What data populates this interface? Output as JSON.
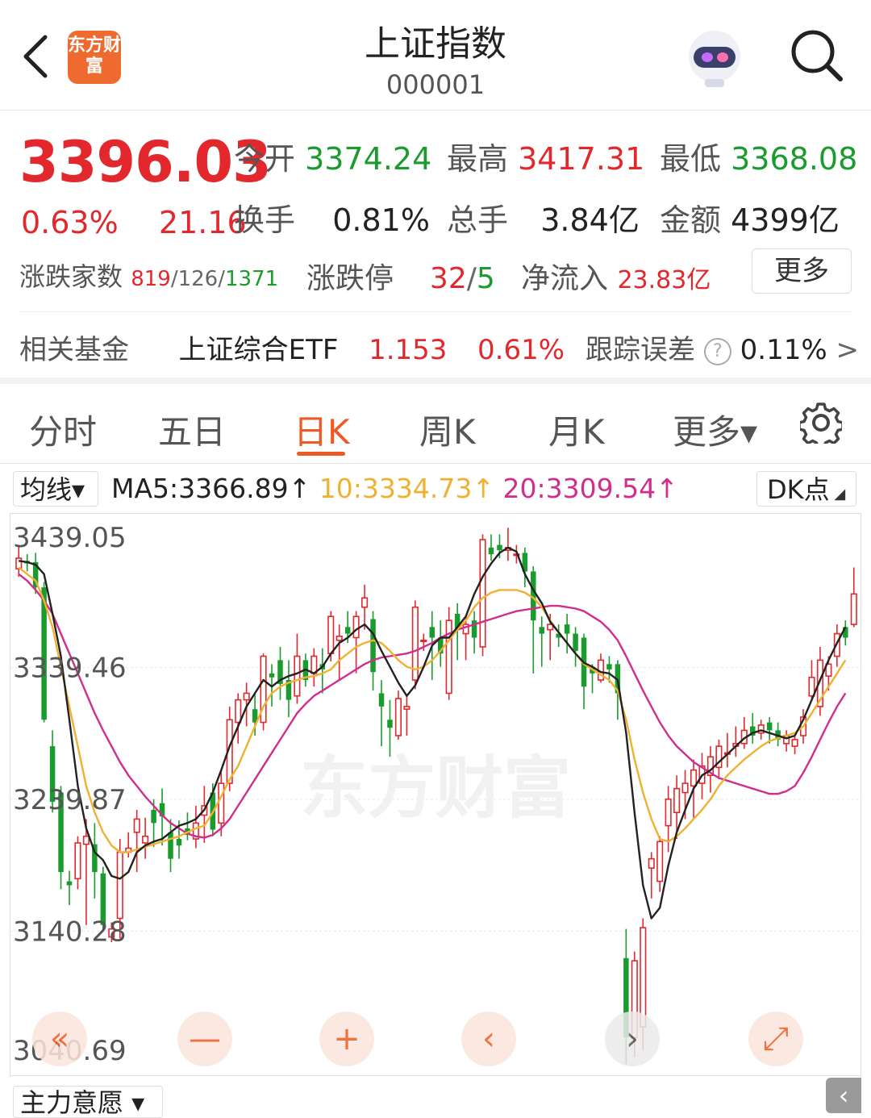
{
  "header": {
    "back_icon": "chevron-left-icon",
    "logo_text": "东方财富",
    "title": "上证指数",
    "code": "000001",
    "robot_icon": "robot-avatar-icon",
    "search_icon": "search-icon"
  },
  "quote": {
    "price": "3396.03",
    "change_pct": "0.63%",
    "change": "21.16",
    "open_label": "今开",
    "open": "3374.24",
    "high_label": "最高",
    "high": "3417.31",
    "low_label": "最低",
    "low": "3368.08",
    "turnover_label": "换手",
    "turnover": "0.81%",
    "volume_label": "总手",
    "volume": "3.84亿",
    "amount_label": "金额",
    "amount": "4399亿",
    "breadth_label": "涨跌家数",
    "breadth_up": "819",
    "breadth_sep1": "/",
    "breadth_flat": "126",
    "breadth_sep2": "/",
    "breadth_down": "1371",
    "limit_label": "涨跌停",
    "limit_up": "32",
    "limit_sep": "/",
    "limit_down": "5",
    "netflow_label": "净流入",
    "netflow": "23.83亿",
    "more_label": "更多"
  },
  "fund": {
    "label": "相关基金",
    "name": "上证综合ETF",
    "price": "1.153",
    "change_pct": "0.61%",
    "tracking_label": "跟踪误差",
    "tracking_value": "0.11%",
    "arrow": ">"
  },
  "tabs": [
    {
      "label": "分时"
    },
    {
      "label": "五日"
    },
    {
      "label": "日K"
    },
    {
      "label": "周K"
    },
    {
      "label": "月K"
    },
    {
      "label": "更多▾"
    }
  ],
  "active_tab": "日K",
  "ma": {
    "select_label": "均线▾",
    "ma5": "MA5:3366.89↑",
    "ma10": "10:3334.73↑",
    "ma20": "20:3309.54↑",
    "dk_label": "DK点",
    "ma5_color": "#222222",
    "ma10_color": "#f0b132",
    "ma20_color": "#d12e8c"
  },
  "chart_data": {
    "type": "candlestick",
    "y_ticks": [
      "3439.05",
      "3339.46",
      "3239.87",
      "3140.28",
      "3040.69"
    ],
    "ylim": [
      3040.69,
      3439.05
    ],
    "watermark": "东方财富",
    "colors": {
      "up": "#e2282d",
      "down": "#1a9b2e"
    },
    "candles": [
      {
        "o": 3414,
        "c": 3422,
        "h": 3432,
        "l": 3408
      },
      {
        "o": 3420,
        "c": 3418,
        "h": 3425,
        "l": 3412
      },
      {
        "o": 3419,
        "c": 3400,
        "h": 3426,
        "l": 3395
      },
      {
        "o": 3400,
        "c": 3300,
        "h": 3404,
        "l": 3298
      },
      {
        "o": 3280,
        "c": 3238,
        "h": 3292,
        "l": 3230
      },
      {
        "o": 3245,
        "c": 3185,
        "h": 3250,
        "l": 3172
      },
      {
        "o": 3178,
        "c": 3175,
        "h": 3186,
        "l": 3160
      },
      {
        "o": 3180,
        "c": 3207,
        "h": 3212,
        "l": 3172
      },
      {
        "o": 3206,
        "c": 3212,
        "h": 3225,
        "l": 3145
      },
      {
        "o": 3206,
        "c": 3185,
        "h": 3222,
        "l": 3165
      },
      {
        "o": 3184,
        "c": 3145,
        "h": 3189,
        "l": 3140
      },
      {
        "o": 3136,
        "c": 3142,
        "h": 3147,
        "l": 3132
      },
      {
        "o": 3150,
        "c": 3200,
        "h": 3210,
        "l": 3135
      },
      {
        "o": 3200,
        "c": 3203,
        "h": 3215,
        "l": 3196
      },
      {
        "o": 3215,
        "c": 3225,
        "h": 3232,
        "l": 3185
      },
      {
        "o": 3207,
        "c": 3212,
        "h": 3226,
        "l": 3195
      },
      {
        "o": 3232,
        "c": 3222,
        "h": 3240,
        "l": 3204
      },
      {
        "o": 3237,
        "c": 3227,
        "h": 3248,
        "l": 3205
      },
      {
        "o": 3215,
        "c": 3195,
        "h": 3225,
        "l": 3185
      },
      {
        "o": 3210,
        "c": 3205,
        "h": 3224,
        "l": 3195
      },
      {
        "o": 3218,
        "c": 3213,
        "h": 3230,
        "l": 3209
      },
      {
        "o": 3210,
        "c": 3222,
        "h": 3235,
        "l": 3203
      },
      {
        "o": 3228,
        "c": 3235,
        "h": 3250,
        "l": 3207
      },
      {
        "o": 3245,
        "c": 3217,
        "h": 3252,
        "l": 3212
      },
      {
        "o": 3222,
        "c": 3252,
        "h": 3262,
        "l": 3212
      },
      {
        "o": 3252,
        "c": 3300,
        "h": 3310,
        "l": 3246
      },
      {
        "o": 3298,
        "c": 3315,
        "h": 3320,
        "l": 3282
      },
      {
        "o": 3315,
        "c": 3320,
        "h": 3328,
        "l": 3295
      },
      {
        "o": 3308,
        "c": 3298,
        "h": 3320,
        "l": 3288
      },
      {
        "o": 3298,
        "c": 3348,
        "h": 3350,
        "l": 3292
      },
      {
        "o": 3335,
        "c": 3332,
        "h": 3342,
        "l": 3310
      },
      {
        "o": 3345,
        "c": 3327,
        "h": 3355,
        "l": 3315
      },
      {
        "o": 3330,
        "c": 3315,
        "h": 3345,
        "l": 3302
      },
      {
        "o": 3318,
        "c": 3348,
        "h": 3365,
        "l": 3312
      },
      {
        "o": 3345,
        "c": 3330,
        "h": 3350,
        "l": 3325
      },
      {
        "o": 3335,
        "c": 3348,
        "h": 3354,
        "l": 3325
      },
      {
        "o": 3342,
        "c": 3338,
        "h": 3354,
        "l": 3320
      },
      {
        "o": 3350,
        "c": 3378,
        "h": 3382,
        "l": 3344
      },
      {
        "o": 3360,
        "c": 3363,
        "h": 3372,
        "l": 3330
      },
      {
        "o": 3370,
        "c": 3365,
        "h": 3382,
        "l": 3358
      },
      {
        "o": 3362,
        "c": 3378,
        "h": 3382,
        "l": 3335
      },
      {
        "o": 3385,
        "c": 3392,
        "h": 3402,
        "l": 3368
      },
      {
        "o": 3376,
        "c": 3336,
        "h": 3382,
        "l": 3322
      },
      {
        "o": 3320,
        "c": 3310,
        "h": 3330,
        "l": 3280
      },
      {
        "o": 3300,
        "c": 3294,
        "h": 3315,
        "l": 3272
      },
      {
        "o": 3288,
        "c": 3316,
        "h": 3322,
        "l": 3285
      },
      {
        "o": 3308,
        "c": 3310,
        "h": 3318,
        "l": 3288
      },
      {
        "o": 3330,
        "c": 3385,
        "h": 3390,
        "l": 3323
      },
      {
        "o": 3360,
        "c": 3360,
        "h": 3365,
        "l": 3352
      },
      {
        "o": 3370,
        "c": 3362,
        "h": 3382,
        "l": 3330
      },
      {
        "o": 3362,
        "c": 3350,
        "h": 3375,
        "l": 3340
      },
      {
        "o": 3320,
        "c": 3375,
        "h": 3385,
        "l": 3315
      },
      {
        "o": 3380,
        "c": 3368,
        "h": 3388,
        "l": 3345
      },
      {
        "o": 3365,
        "c": 3372,
        "h": 3378,
        "l": 3345
      },
      {
        "o": 3375,
        "c": 3362,
        "h": 3382,
        "l": 3350
      },
      {
        "o": 3355,
        "c": 3436,
        "h": 3440,
        "l": 3348
      },
      {
        "o": 3430,
        "c": 3425,
        "h": 3440,
        "l": 3420
      },
      {
        "o": 3432,
        "c": 3428,
        "h": 3440,
        "l": 3422
      },
      {
        "o": 3428,
        "c": 3430,
        "h": 3445,
        "l": 3420
      },
      {
        "o": 3425,
        "c": 3425,
        "h": 3432,
        "l": 3418
      },
      {
        "o": 3426,
        "c": 3412,
        "h": 3430,
        "l": 3400
      },
      {
        "o": 3412,
        "c": 3375,
        "h": 3416,
        "l": 3335
      },
      {
        "o": 3370,
        "c": 3365,
        "h": 3378,
        "l": 3340
      },
      {
        "o": 3368,
        "c": 3372,
        "h": 3380,
        "l": 3345
      },
      {
        "o": 3365,
        "c": 3362,
        "h": 3372,
        "l": 3355
      },
      {
        "o": 3372,
        "c": 3365,
        "h": 3380,
        "l": 3350
      },
      {
        "o": 3365,
        "c": 3352,
        "h": 3370,
        "l": 3340
      },
      {
        "o": 3362,
        "c": 3325,
        "h": 3365,
        "l": 3308
      },
      {
        "o": 3340,
        "c": 3335,
        "h": 3342,
        "l": 3320
      },
      {
        "o": 3330,
        "c": 3345,
        "h": 3350,
        "l": 3328
      },
      {
        "o": 3342,
        "c": 3338,
        "h": 3348,
        "l": 3328
      },
      {
        "o": 3342,
        "c": 3320,
        "h": 3345,
        "l": 3300
      },
      {
        "o": 3120,
        "c": 3060,
        "h": 3142,
        "l": 3040
      },
      {
        "o": 3060,
        "c": 3118,
        "h": 3125,
        "l": 3045
      },
      {
        "o": 3068,
        "c": 3143,
        "h": 3150,
        "l": 3050
      },
      {
        "o": 3188,
        "c": 3195,
        "h": 3200,
        "l": 3165
      },
      {
        "o": 3178,
        "c": 3208,
        "h": 3212,
        "l": 3170
      },
      {
        "o": 3220,
        "c": 3240,
        "h": 3250,
        "l": 3200
      },
      {
        "o": 3230,
        "c": 3248,
        "h": 3258,
        "l": 3210
      },
      {
        "o": 3245,
        "c": 3252,
        "h": 3262,
        "l": 3225
      },
      {
        "o": 3250,
        "c": 3262,
        "h": 3270,
        "l": 3225
      },
      {
        "o": 3252,
        "c": 3265,
        "h": 3275,
        "l": 3240
      },
      {
        "o": 3258,
        "c": 3272,
        "h": 3280,
        "l": 3245
      },
      {
        "o": 3264,
        "c": 3280,
        "h": 3285,
        "l": 3255
      },
      {
        "o": 3274,
        "c": 3275,
        "h": 3290,
        "l": 3264
      },
      {
        "o": 3280,
        "c": 3282,
        "h": 3295,
        "l": 3272
      },
      {
        "o": 3282,
        "c": 3292,
        "h": 3302,
        "l": 3278
      },
      {
        "o": 3295,
        "c": 3288,
        "h": 3305,
        "l": 3282
      },
      {
        "o": 3290,
        "c": 3296,
        "h": 3300,
        "l": 3285
      },
      {
        "o": 3298,
        "c": 3292,
        "h": 3302,
        "l": 3282
      },
      {
        "o": 3292,
        "c": 3285,
        "h": 3298,
        "l": 3280
      },
      {
        "o": 3282,
        "c": 3288,
        "h": 3292,
        "l": 3276
      },
      {
        "o": 3280,
        "c": 3285,
        "h": 3290,
        "l": 3274
      },
      {
        "o": 3288,
        "c": 3302,
        "h": 3308,
        "l": 3282
      },
      {
        "o": 3318,
        "c": 3332,
        "h": 3345,
        "l": 3315
      },
      {
        "o": 3310,
        "c": 3345,
        "h": 3355,
        "l": 3303
      },
      {
        "o": 3333,
        "c": 3342,
        "h": 3348,
        "l": 3322
      },
      {
        "o": 3348,
        "c": 3365,
        "h": 3372,
        "l": 3340
      },
      {
        "o": 3370,
        "c": 3362,
        "h": 3375,
        "l": 3356
      },
      {
        "o": 3372,
        "c": 3395,
        "h": 3415,
        "l": 3370
      }
    ],
    "ma5": [
      3420,
      3419,
      3417,
      3410,
      3380,
      3348,
      3300,
      3250,
      3218,
      3200,
      3194,
      3182,
      3180,
      3185,
      3200,
      3205,
      3208,
      3210,
      3215,
      3220,
      3222,
      3225,
      3232,
      3245,
      3262,
      3280,
      3295,
      3310,
      3320,
      3330,
      3325,
      3330,
      3333,
      3335,
      3338,
      3335,
      3340,
      3350,
      3358,
      3362,
      3368,
      3372,
      3365,
      3352,
      3340,
      3328,
      3318,
      3326,
      3340,
      3356,
      3362,
      3362,
      3370,
      3378,
      3395,
      3408,
      3418,
      3426,
      3430,
      3427,
      3410,
      3398,
      3388,
      3374,
      3366,
      3358,
      3350,
      3343,
      3340,
      3336,
      3335,
      3330,
      3290,
      3230,
      3175,
      3150,
      3158,
      3190,
      3215,
      3232,
      3248,
      3258,
      3262,
      3268,
      3274,
      3280,
      3286,
      3290,
      3292,
      3290,
      3288,
      3286,
      3288,
      3300,
      3315,
      3330,
      3345,
      3358,
      3370
    ],
    "ma10": [
      3415,
      3410,
      3405,
      3390,
      3370,
      3340,
      3310,
      3280,
      3250,
      3230,
      3215,
      3205,
      3200,
      3200,
      3202,
      3204,
      3206,
      3208,
      3210,
      3212,
      3215,
      3218,
      3220,
      3230,
      3242,
      3255,
      3265,
      3280,
      3295,
      3310,
      3320,
      3325,
      3328,
      3330,
      3332,
      3333,
      3335,
      3338,
      3345,
      3350,
      3355,
      3358,
      3360,
      3358,
      3352,
      3345,
      3340,
      3338,
      3340,
      3345,
      3352,
      3360,
      3368,
      3375,
      3385,
      3392,
      3396,
      3398,
      3398,
      3398,
      3396,
      3392,
      3385,
      3375,
      3366,
      3358,
      3350,
      3342,
      3338,
      3334,
      3330,
      3322,
      3300,
      3270,
      3245,
      3225,
      3210,
      3208,
      3212,
      3218,
      3225,
      3232,
      3240,
      3250,
      3258,
      3264,
      3270,
      3275,
      3280,
      3284,
      3286,
      3288,
      3290,
      3295,
      3305,
      3315,
      3325,
      3335,
      3345
    ],
    "ma20": [
      3410,
      3405,
      3398,
      3390,
      3380,
      3365,
      3350,
      3335,
      3320,
      3305,
      3292,
      3280,
      3268,
      3258,
      3250,
      3242,
      3235,
      3228,
      3222,
      3218,
      3214,
      3212,
      3211,
      3213,
      3218,
      3225,
      3235,
      3245,
      3255,
      3265,
      3275,
      3285,
      3295,
      3305,
      3312,
      3318,
      3322,
      3326,
      3330,
      3334,
      3338,
      3342,
      3345,
      3347,
      3348,
      3349,
      3350,
      3352,
      3355,
      3358,
      3362,
      3365,
      3368,
      3370,
      3372,
      3374,
      3376,
      3378,
      3380,
      3382,
      3383,
      3384,
      3385,
      3386,
      3386,
      3385,
      3384,
      3382,
      3378,
      3374,
      3368,
      3360,
      3348,
      3335,
      3322,
      3310,
      3298,
      3288,
      3280,
      3274,
      3268,
      3264,
      3260,
      3256,
      3254,
      3252,
      3250,
      3248,
      3246,
      3244,
      3244,
      3246,
      3250,
      3260,
      3272,
      3285,
      3298,
      3310,
      3320
    ]
  },
  "controls": [
    {
      "icon": "double-chevron-left-icon",
      "symbol": "«"
    },
    {
      "icon": "minus-icon",
      "symbol": "—"
    },
    {
      "icon": "plus-icon",
      "symbol": "+"
    },
    {
      "icon": "chevron-left-icon",
      "symbol": "‹"
    },
    {
      "icon": "chevron-right-icon",
      "symbol": "›"
    },
    {
      "icon": "expand-icon",
      "symbol": "⤢"
    }
  ],
  "bottom": {
    "select_label": "主力意愿 ▾",
    "toggle_symbol": "‹"
  }
}
